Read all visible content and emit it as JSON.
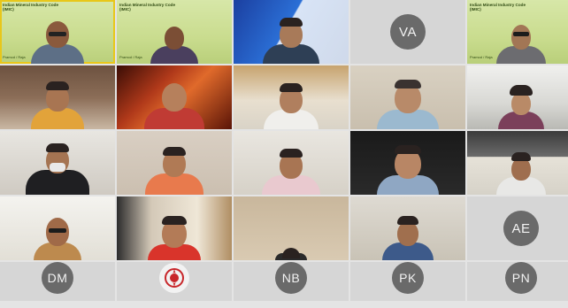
{
  "meeting": {
    "org_overlay": "Indian Mineral Industry Code (IMIC)",
    "org_overlay_sub": "Pramod / Raja"
  },
  "avatars": {
    "r1c4": "VA",
    "r4c5": "AE",
    "r5c1": "DM",
    "r5c3": "NB",
    "r5c4": "PK",
    "r5c5": "PN"
  },
  "colors": {
    "active_border": "#e8c71a",
    "avatar_bg": "#6a6a6a",
    "tile_gap": "#e4e4e4"
  }
}
